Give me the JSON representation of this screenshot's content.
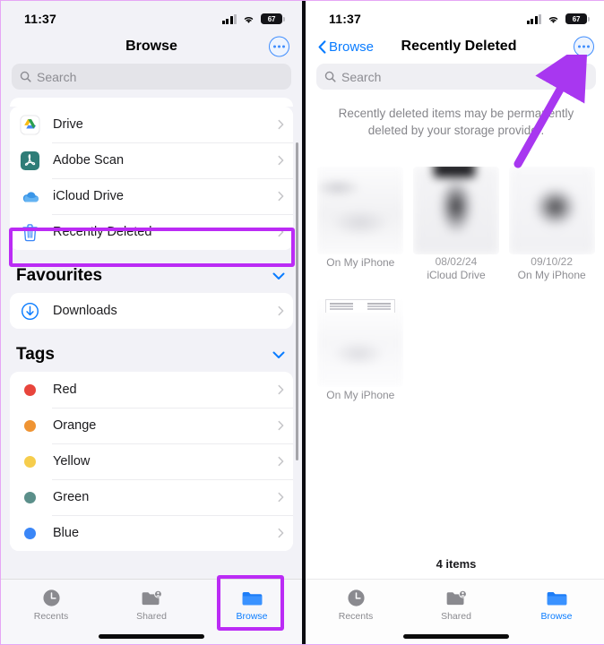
{
  "annotations": {
    "highlight_color": "#bb2bf5",
    "arrow_color": "#a837f0",
    "highlighted_targets": [
      "Recently Deleted",
      "Browse tab",
      "More options button"
    ]
  },
  "left_panel": {
    "status": {
      "time": "11:37",
      "battery_percent": "67",
      "signal_icon": "cellular-signal-icon",
      "wifi_icon": "wifi-icon",
      "battery_icon": "battery-icon"
    },
    "nav": {
      "title": "Browse",
      "more_icon": "more-options-icon"
    },
    "search": {
      "placeholder": "Search",
      "icon": "search-icon"
    },
    "locations": [
      {
        "label": "Drive",
        "icon": "google-drive-icon"
      },
      {
        "label": "Adobe Scan",
        "icon": "adobe-scan-icon"
      },
      {
        "label": "iCloud Drive",
        "icon": "icloud-drive-icon"
      },
      {
        "label": "Recently Deleted",
        "icon": "trash-icon"
      }
    ],
    "favourites_section": {
      "title": "Favourites",
      "collapse_icon": "chevron-down-icon",
      "items": [
        {
          "label": "Downloads",
          "icon": "download-circle-icon"
        }
      ]
    },
    "tags_section": {
      "title": "Tags",
      "collapse_icon": "chevron-down-icon",
      "items": [
        {
          "label": "Red",
          "color": "#e8453c"
        },
        {
          "label": "Orange",
          "color": "#ef9433"
        },
        {
          "label": "Yellow",
          "color": "#f6cd4c"
        },
        {
          "label": "Green",
          "color": "#5b8f8a"
        },
        {
          "label": "Blue",
          "color": "#3a86f7"
        }
      ]
    },
    "tabbar": {
      "tabs": [
        {
          "label": "Recents",
          "icon": "clock-icon",
          "active": false
        },
        {
          "label": "Shared",
          "icon": "shared-folder-icon",
          "active": false
        },
        {
          "label": "Browse",
          "icon": "folder-icon",
          "active": true
        }
      ]
    }
  },
  "right_panel": {
    "status": {
      "time": "11:37",
      "battery_percent": "67",
      "signal_icon": "cellular-signal-icon",
      "wifi_icon": "wifi-icon",
      "battery_icon": "battery-icon"
    },
    "nav": {
      "back_label": "Browse",
      "back_icon": "chevron-left-icon",
      "title": "Recently Deleted",
      "more_icon": "more-options-icon"
    },
    "search": {
      "placeholder": "Search",
      "icon": "search-icon"
    },
    "notice": "Recently deleted items may be permanently deleted by your storage provider.",
    "items": [
      {
        "date": "",
        "location": "On My iPhone",
        "thumb": "blurred-document-thumbnail"
      },
      {
        "date": "08/02/24",
        "location": "iCloud Drive",
        "thumb": "blurred-photo-thumbnail"
      },
      {
        "date": "09/10/22",
        "location": "On My iPhone",
        "thumb": "blurred-photo-thumbnail"
      },
      {
        "date": "",
        "location": "On My iPhone",
        "thumb": "blurred-document-thumbnail"
      }
    ],
    "items_count": "4 items",
    "tabbar": {
      "tabs": [
        {
          "label": "Recents",
          "icon": "clock-icon",
          "active": false
        },
        {
          "label": "Shared",
          "icon": "shared-folder-icon",
          "active": false
        },
        {
          "label": "Browse",
          "icon": "folder-icon",
          "active": true
        }
      ]
    }
  }
}
